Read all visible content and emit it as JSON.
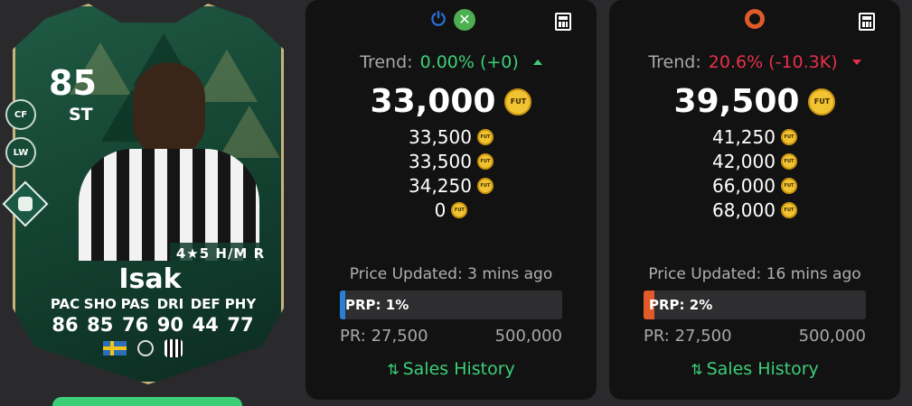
{
  "card": {
    "rating": "85",
    "position": "ST",
    "alt_positions": [
      "CF",
      "LW"
    ],
    "skills": "4★5 H/M R",
    "name": "Isak",
    "stat_labels": [
      "PAC",
      "SHO",
      "PAS",
      "DRI",
      "DEF",
      "PHY"
    ],
    "stat_values": [
      "86",
      "85",
      "76",
      "90",
      "44",
      "77"
    ],
    "theme_color": "#1f5a44",
    "border_color": "#c8b47a"
  },
  "panels": [
    {
      "platform_icons": [
        "playstation-icon",
        "xbox-icon"
      ],
      "trend_label": "Trend:",
      "trend_value": "0.00% (+0)",
      "trend_direction": "up",
      "main_price": "33,000",
      "prices": [
        "33,500",
        "33,500",
        "34,250",
        "0"
      ],
      "updated": "Price Updated: 3 mins ago",
      "prp_label": "PRP: 1%",
      "prp_fraction": 0.01,
      "prp_color": "#2a7fd6",
      "pr_min": "PR: 27,500",
      "pr_max": "500,000",
      "sales_label": "Sales History"
    },
    {
      "platform_icons": [
        "origin-icon"
      ],
      "trend_label": "Trend:",
      "trend_value": "20.6% (-10.3K)",
      "trend_direction": "down",
      "main_price": "39,500",
      "prices": [
        "41,250",
        "42,000",
        "66,000",
        "68,000"
      ],
      "updated": "Price Updated: 16 mins ago",
      "prp_label": "PRP: 2%",
      "prp_fraction": 0.02,
      "prp_color": "#e05a2a",
      "pr_min": "PR: 27,500",
      "pr_max": "500,000",
      "sales_label": "Sales History"
    }
  ],
  "coin_text": "FUT",
  "colors": {
    "up": "#3ccf78",
    "down": "#e8304a",
    "panel_bg": "#121212",
    "coin": "#f1c232"
  }
}
